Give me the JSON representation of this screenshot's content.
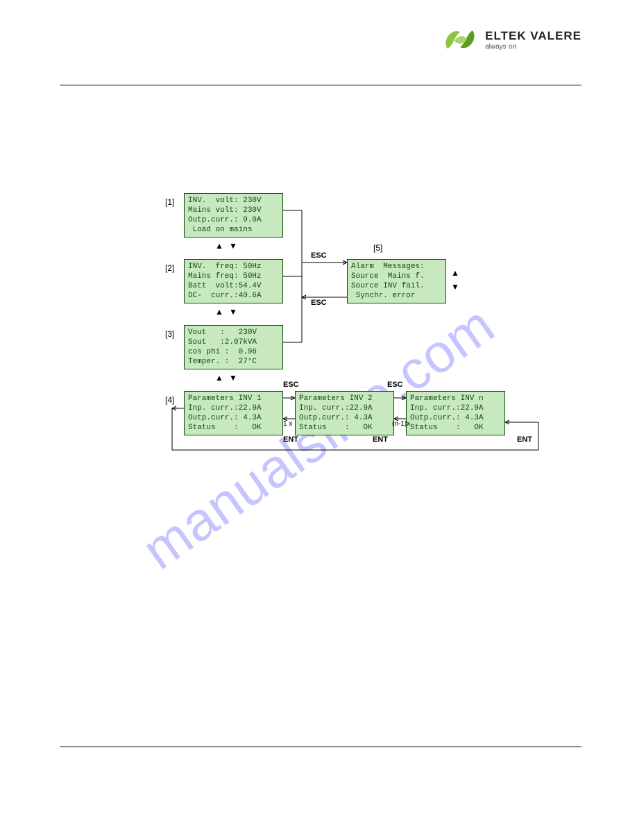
{
  "brand": {
    "name": "ELTEK VALERE",
    "tag_prefix": "always ",
    "tag_accent": "on"
  },
  "watermark": "manualslive.com",
  "labels": {
    "n1": "[1]",
    "n2": "[2]",
    "n3": "[3]",
    "n4": "[4]",
    "n5": "[5]",
    "esc": "ESC",
    "ent": "ENT",
    "onex": "1 x",
    "nminus1x": "(n-1)x"
  },
  "lcd": {
    "b1": {
      "l1": "INV.  volt: 230V",
      "l2": "Mains volt: 230V",
      "l3": "Outp.curr.: 9.0A",
      "l4": " Load on mains"
    },
    "b2": {
      "l1": "INV.  freq: 50Hz",
      "l2": "Mains freq: 50Hz",
      "l3": "Batt  volt:54.4V",
      "l4": "DC-  curr.:40.6A"
    },
    "b3": {
      "l1": "Vout   :   230V",
      "l2": "Sout   :2.07kVA",
      "l3": "cos phi :  0.96",
      "l4": "Temper. :  27°C"
    },
    "b4": {
      "l1": "Parameters INV 1",
      "l2": "Inp. curr.:22.9A",
      "l3": "Outp.curr.: 4.3A",
      "l4": "Status    :   OK"
    },
    "b5": {
      "l1": "Alarm  Messages:",
      "l2": "Source  Mains f.",
      "l3": "Source INV fail.",
      "l4": " Synchr. error"
    },
    "b6": {
      "l1": "Parameters INV 2",
      "l2": "Inp. curr.:22.9A",
      "l3": "Outp.curr.: 4.3A",
      "l4": "Status    :   OK"
    },
    "b7": {
      "l1": "Parameters INV n",
      "l2": "Inp. curr.:22.9A",
      "l3": "Outp.curr.: 4.3A",
      "l4": "Status    :   OK"
    }
  }
}
